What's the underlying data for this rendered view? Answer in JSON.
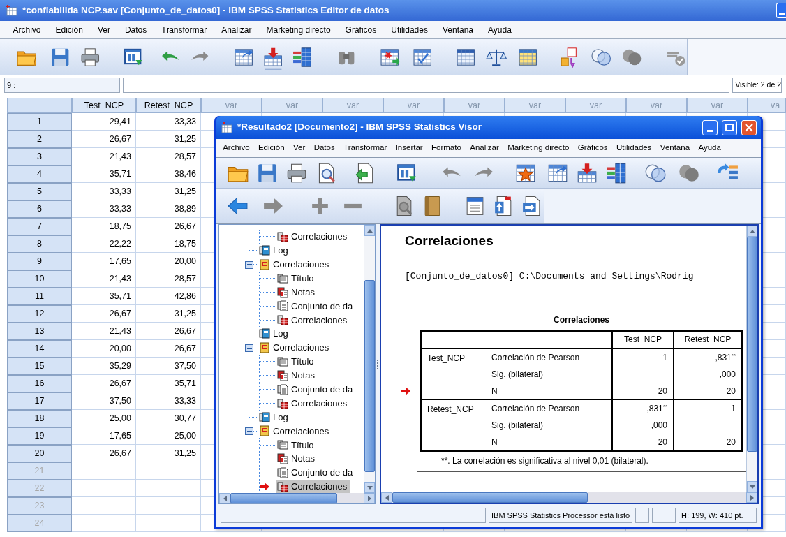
{
  "editor": {
    "title": "*confiabilida NCP.sav [Conjunto_de_datos0] - IBM SPSS Statistics Editor de datos",
    "menu": [
      "Archivo",
      "Edición",
      "Ver",
      "Datos",
      "Transformar",
      "Analizar",
      "Marketing directo",
      "Gráficos",
      "Utilidades",
      "Ventana",
      "Ayuda"
    ],
    "cell_ref": "9 :",
    "visible_label": "Visible: 2 de 2",
    "columns": [
      {
        "label": "Test_NCP",
        "defined": true
      },
      {
        "label": "Retest_NCP",
        "defined": true
      },
      {
        "label": "var",
        "defined": false
      },
      {
        "label": "var",
        "defined": false
      },
      {
        "label": "var",
        "defined": false
      },
      {
        "label": "var",
        "defined": false
      },
      {
        "label": "var",
        "defined": false
      },
      {
        "label": "var",
        "defined": false
      },
      {
        "label": "var",
        "defined": false
      },
      {
        "label": "var",
        "defined": false
      },
      {
        "label": "var",
        "defined": false
      },
      {
        "label": "va",
        "defined": false
      }
    ],
    "rows": [
      {
        "number": "1",
        "greyed": false,
        "values": [
          "29,41",
          "33,33"
        ]
      },
      {
        "number": "2",
        "greyed": false,
        "values": [
          "26,67",
          "31,25"
        ]
      },
      {
        "number": "3",
        "greyed": false,
        "values": [
          "21,43",
          "28,57"
        ]
      },
      {
        "number": "4",
        "greyed": false,
        "values": [
          "35,71",
          "38,46"
        ]
      },
      {
        "number": "5",
        "greyed": false,
        "values": [
          "33,33",
          "31,25"
        ]
      },
      {
        "number": "6",
        "greyed": false,
        "values": [
          "33,33",
          "38,89"
        ]
      },
      {
        "number": "7",
        "greyed": false,
        "values": [
          "18,75",
          "26,67"
        ]
      },
      {
        "number": "8",
        "greyed": false,
        "values": [
          "22,22",
          "18,75"
        ]
      },
      {
        "number": "9",
        "greyed": false,
        "values": [
          "17,65",
          "20,00"
        ]
      },
      {
        "number": "10",
        "greyed": false,
        "values": [
          "21,43",
          "28,57"
        ]
      },
      {
        "number": "11",
        "greyed": false,
        "values": [
          "35,71",
          "42,86"
        ]
      },
      {
        "number": "12",
        "greyed": false,
        "values": [
          "26,67",
          "31,25"
        ]
      },
      {
        "number": "13",
        "greyed": false,
        "values": [
          "21,43",
          "26,67"
        ]
      },
      {
        "number": "14",
        "greyed": false,
        "values": [
          "20,00",
          "26,67"
        ]
      },
      {
        "number": "15",
        "greyed": false,
        "values": [
          "35,29",
          "37,50"
        ]
      },
      {
        "number": "16",
        "greyed": false,
        "values": [
          "26,67",
          "35,71"
        ]
      },
      {
        "number": "17",
        "greyed": false,
        "values": [
          "37,50",
          "33,33"
        ]
      },
      {
        "number": "18",
        "greyed": false,
        "values": [
          "25,00",
          "30,77"
        ]
      },
      {
        "number": "19",
        "greyed": false,
        "values": [
          "17,65",
          "25,00"
        ]
      },
      {
        "number": "20",
        "greyed": false,
        "values": [
          "26,67",
          "31,25"
        ]
      },
      {
        "number": "21",
        "greyed": true
      },
      {
        "number": "22",
        "greyed": true
      },
      {
        "number": "23",
        "greyed": true
      },
      {
        "number": "24",
        "greyed": true
      }
    ]
  },
  "viewer": {
    "title": "*Resultado2 [Documento2] - IBM SPSS Statistics Visor",
    "menu": [
      "Archivo",
      "Edición",
      "Ver",
      "Datos",
      "Transformar",
      "Insertar",
      "Formato",
      "Analizar",
      "Marketing directo",
      "Gráficos",
      "Utilidades",
      "Ventana",
      "Ayuda"
    ],
    "tree": [
      {
        "kind": "group_tail",
        "children": [
          {
            "kind": "table",
            "label": "Correlaciones",
            "selected": false
          }
        ]
      },
      {
        "kind": "log",
        "label": "Log",
        "selected": false
      },
      {
        "kind": "group",
        "label": "Correlaciones",
        "expanded": true,
        "selected": false,
        "children": [
          {
            "kind": "title",
            "label": "Título",
            "selected": false
          },
          {
            "kind": "notes",
            "label": "Notas",
            "selected": false
          },
          {
            "kind": "dataset",
            "label": "Conjunto de da",
            "selected": false
          },
          {
            "kind": "table",
            "label": "Correlaciones",
            "selected": false
          }
        ]
      },
      {
        "kind": "log",
        "label": "Log",
        "selected": false
      },
      {
        "kind": "group",
        "label": "Correlaciones",
        "expanded": true,
        "selected": false,
        "children": [
          {
            "kind": "title",
            "label": "Título",
            "selected": false
          },
          {
            "kind": "notes",
            "label": "Notas",
            "selected": false
          },
          {
            "kind": "dataset",
            "label": "Conjunto de da",
            "selected": false
          },
          {
            "kind": "table",
            "label": "Correlaciones",
            "selected": false
          }
        ]
      },
      {
        "kind": "log",
        "label": "Log",
        "selected": false
      },
      {
        "kind": "group",
        "label": "Correlaciones",
        "expanded": true,
        "selected": false,
        "children": [
          {
            "kind": "title",
            "label": "Título",
            "selected": false
          },
          {
            "kind": "notes",
            "label": "Notas",
            "selected": false
          },
          {
            "kind": "dataset",
            "label": "Conjunto de da",
            "selected": false
          },
          {
            "kind": "table",
            "label": "Correlaciones",
            "selected": true
          }
        ]
      }
    ],
    "output": {
      "heading": "Correlaciones",
      "command_line": "[Conjunto_de_datos0] C:\\Documents and Settings\\Rodrig",
      "table": {
        "title": "Correlaciones",
        "columns": [
          "Test_NCP",
          "Retest_NCP"
        ],
        "groups": [
          {
            "variable": "Test_NCP",
            "rows": [
              {
                "statistic": "Correlación de Pearson",
                "current": false,
                "cells": {
                  "test_ncp": {
                    "text": "1"
                  },
                  "retest_ncp": {
                    "text": ",831",
                    "mark": "**"
                  }
                }
              },
              {
                "statistic": "Sig. (bilateral)",
                "current": false,
                "cells": {
                  "retest_ncp": {
                    "text": ",000"
                  }
                }
              },
              {
                "statistic": "N",
                "current": true,
                "cells": {
                  "test_ncp": {
                    "text": "20"
                  },
                  "retest_ncp": {
                    "text": "20"
                  }
                }
              }
            ]
          },
          {
            "variable": "Retest_NCP",
            "rows": [
              {
                "statistic": "Correlación de Pearson",
                "current": false,
                "cells": {
                  "test_ncp": {
                    "text": ",831",
                    "mark": "**"
                  },
                  "retest_ncp": {
                    "text": "1"
                  }
                }
              },
              {
                "statistic": "Sig. (bilateral)",
                "current": false,
                "cells": {
                  "test_ncp": {
                    "text": ",000"
                  }
                }
              },
              {
                "statistic": "N",
                "current": false,
                "cells": {
                  "test_ncp": {
                    "text": "20"
                  },
                  "retest_ncp": {
                    "text": "20"
                  }
                }
              }
            ]
          }
        ],
        "footnote": "**. La correlación es significativa al nivel 0,01 (bilateral)."
      }
    },
    "status": {
      "message": "IBM SPSS Statistics Processor está listo",
      "size": "H: 199, W: 410 pt."
    }
  }
}
